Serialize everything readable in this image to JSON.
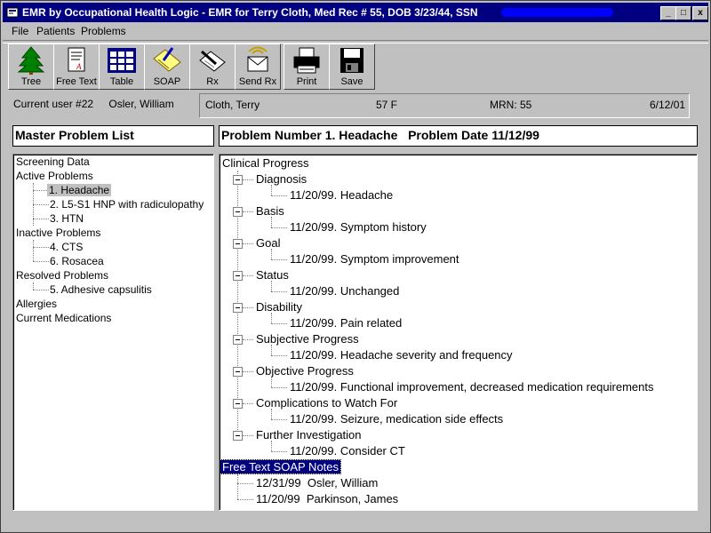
{
  "window": {
    "title": "EMR by Occupational Health Logic - EMR for Terry Cloth, Med Rec # 55, DOB 3/23/44, SSN",
    "controls": [
      "_",
      "□",
      "x"
    ]
  },
  "menu": {
    "file": "File",
    "patients": "Patients",
    "problems": "Problems"
  },
  "toolbar": {
    "tree": "Tree",
    "freetext": "Free Text",
    "table": "Table",
    "soap": "SOAP",
    "rx": "Rx",
    "sendrx": "Send Rx",
    "print": "Print",
    "save": "Save"
  },
  "user": {
    "label": "Current user #22",
    "name": "Osler, William"
  },
  "patient": {
    "name": "Cloth, Terry",
    "agesex": "57 F",
    "mrn": "MRN: 55",
    "date": "6/12/01"
  },
  "master_header": "Master Problem List",
  "problem_header": "Problem Number 1. Headache   Problem Date 11/12/99",
  "master": {
    "screening": "Screening Data",
    "active": "Active Problems",
    "active_items": [
      "1. Headache",
      "2. L5-S1 HNP with radiculopathy",
      "3. HTN"
    ],
    "inactive": "Inactive Problems",
    "inactive_items": [
      "4. CTS",
      "6. Rosacea"
    ],
    "resolved": "Resolved Problems",
    "resolved_items": [
      "5. Adhesive capsulitis"
    ],
    "allergies": "Allergies",
    "meds": "Current Medications"
  },
  "progress": {
    "root": "Clinical Progress",
    "sections": [
      {
        "label": "Diagnosis",
        "entry": "11/20/99. Headache"
      },
      {
        "label": "Basis",
        "entry": "11/20/99. Symptom history"
      },
      {
        "label": "Goal",
        "entry": "11/20/99. Symptom improvement"
      },
      {
        "label": "Status",
        "entry": "11/20/99. Unchanged"
      },
      {
        "label": "Disability",
        "entry": "11/20/99. Pain related"
      },
      {
        "label": "Subjective Progress",
        "entry": "11/20/99. Headache severity and frequency"
      },
      {
        "label": "Objective Progress",
        "entry": "11/20/99. Functional improvement, decreased medication requirements"
      },
      {
        "label": "Complications to Watch For",
        "entry": "11/20/99. Seizure, medication side effects"
      },
      {
        "label": "Further Investigation",
        "entry": "11/20/99. Consider CT"
      }
    ],
    "soap_root": "Free Text SOAP Notes",
    "soap_notes": [
      "12/31/99  Osler, William",
      "11/20/99  Parkinson, James"
    ]
  },
  "colors": {
    "titlebar": "#000080",
    "face": "#c0c0c0",
    "redaction": "#0000ff"
  }
}
